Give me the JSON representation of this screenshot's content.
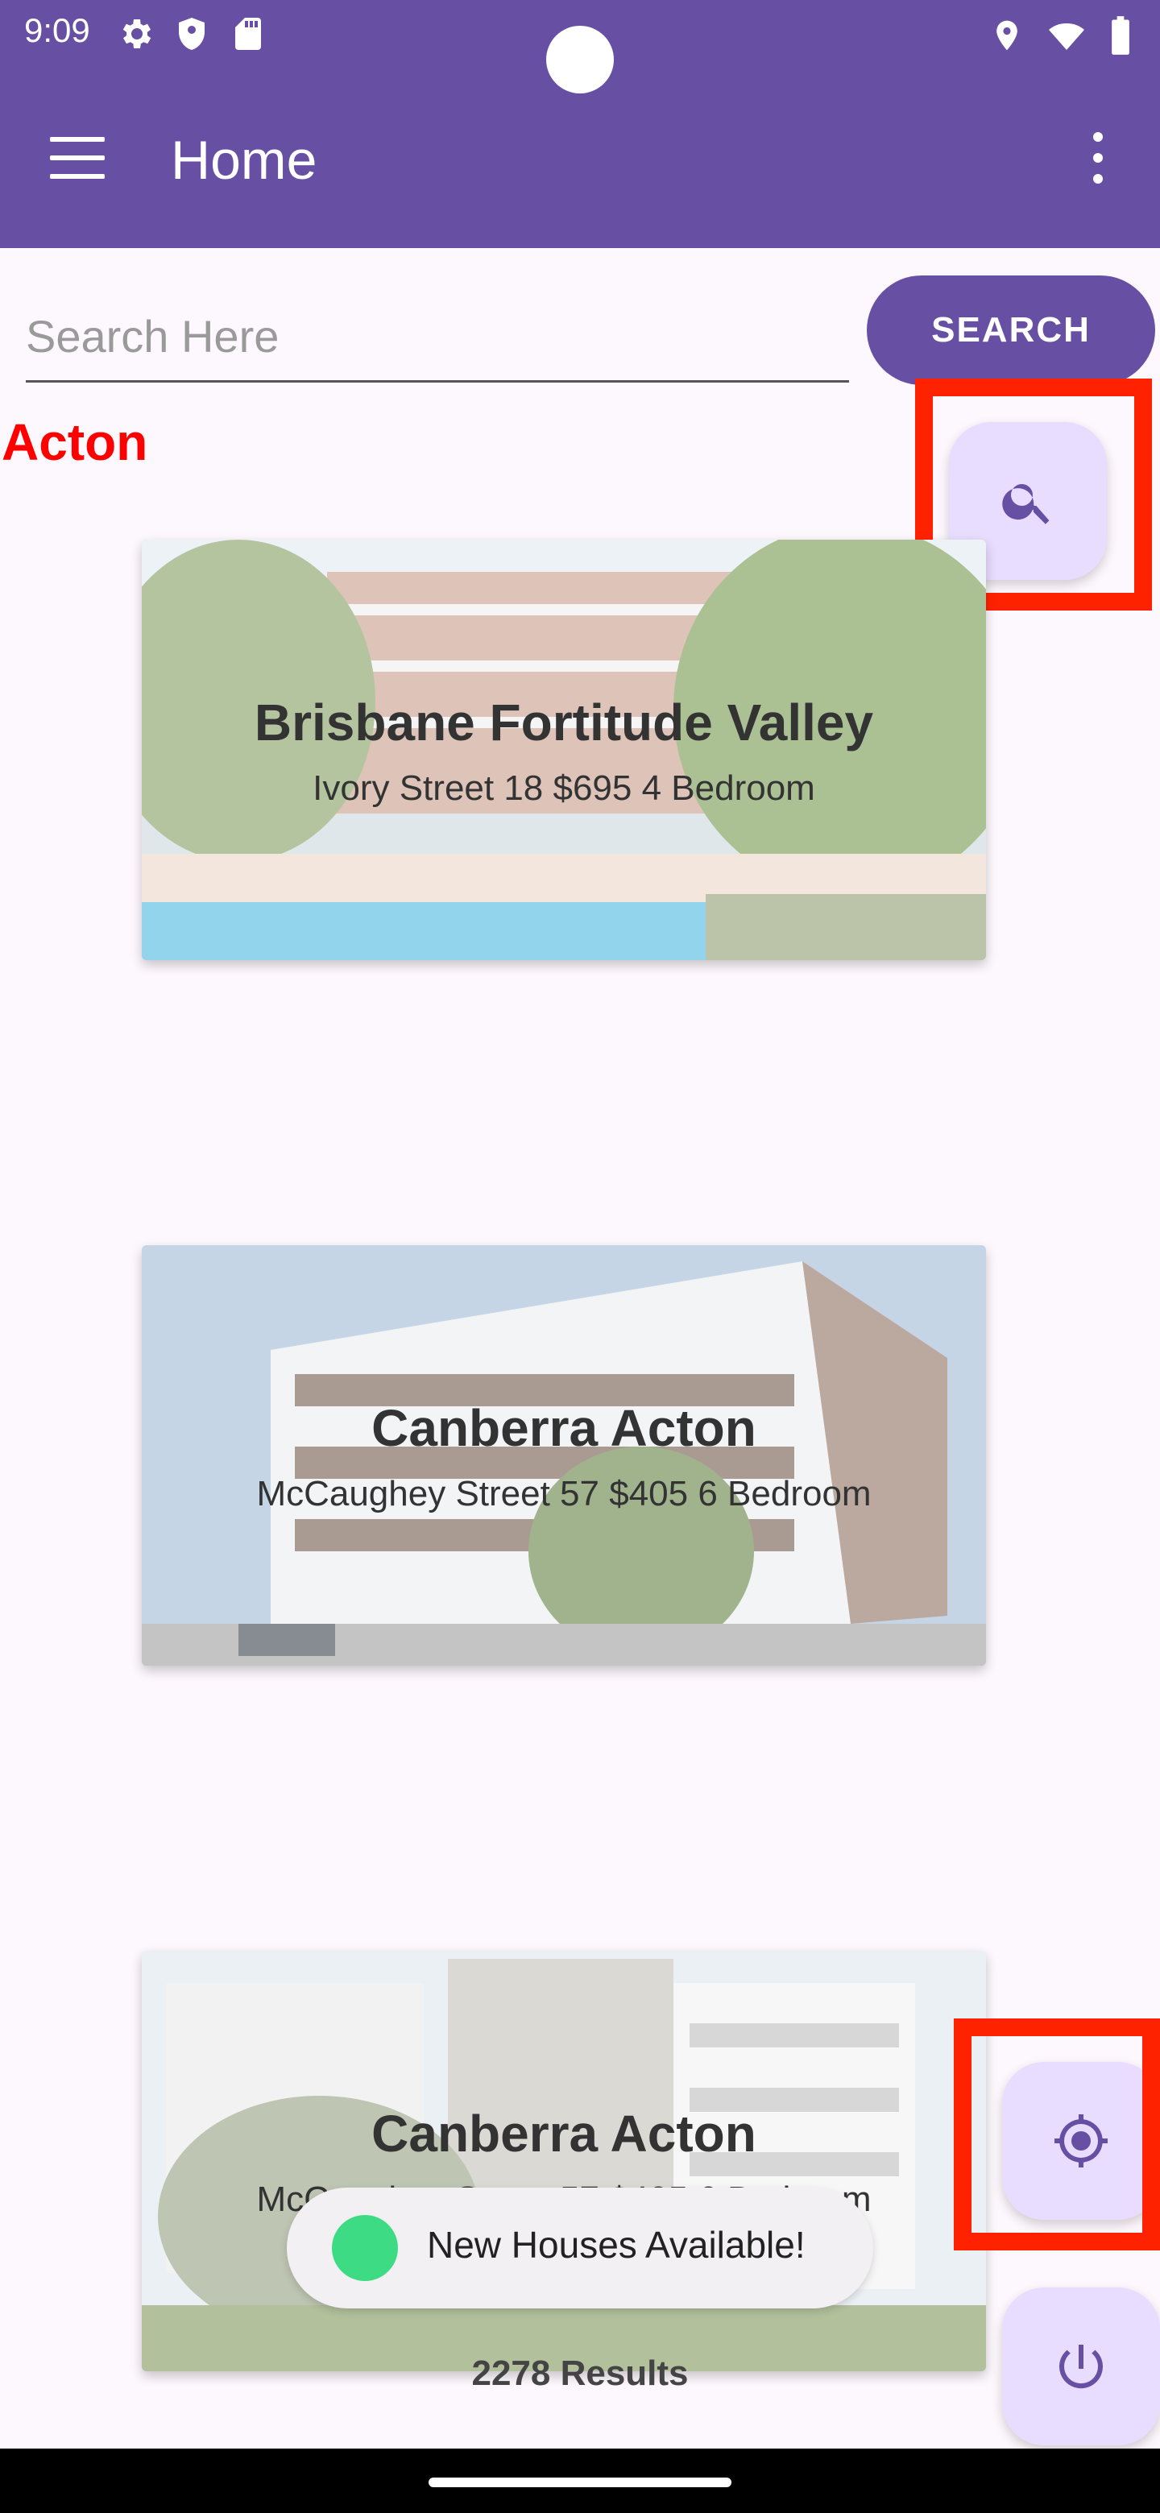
{
  "status_bar": {
    "time": "9:09",
    "left_icons": [
      "gear-icon",
      "shield-icon",
      "sd-card-icon"
    ],
    "right_icons": [
      "location-icon",
      "wifi-icon",
      "battery-icon"
    ]
  },
  "toolbar": {
    "title": "Home",
    "menu_icon": "hamburger-icon",
    "overflow_icon": "more-vert-icon"
  },
  "search": {
    "placeholder": "Search Here",
    "value": "",
    "button_label": "SEARCH"
  },
  "location_label": "Acton",
  "listings": [
    {
      "title": "Brisbane Fortitude Valley",
      "subtitle": "Ivory Street 18 $695 4 Bedroom"
    },
    {
      "title": "Canberra Acton",
      "subtitle": "McCaughey Street 57 $405 6 Bedroom"
    },
    {
      "title": "Canberra Acton",
      "subtitle": "McCaughey Street 57 $405 6 Bedroom"
    }
  ],
  "toast": {
    "text": "New Houses Available!",
    "icon": "android-icon"
  },
  "results_label": "2278 Results",
  "fabs": {
    "search_icon": "search-icon",
    "locate_icon": "my-location-icon",
    "power_icon": "power-icon"
  },
  "colors": {
    "primary": "#674fa3",
    "fab_background": "#e9ddff",
    "highlight": "#ff2200",
    "location_label": "#ff0000"
  }
}
